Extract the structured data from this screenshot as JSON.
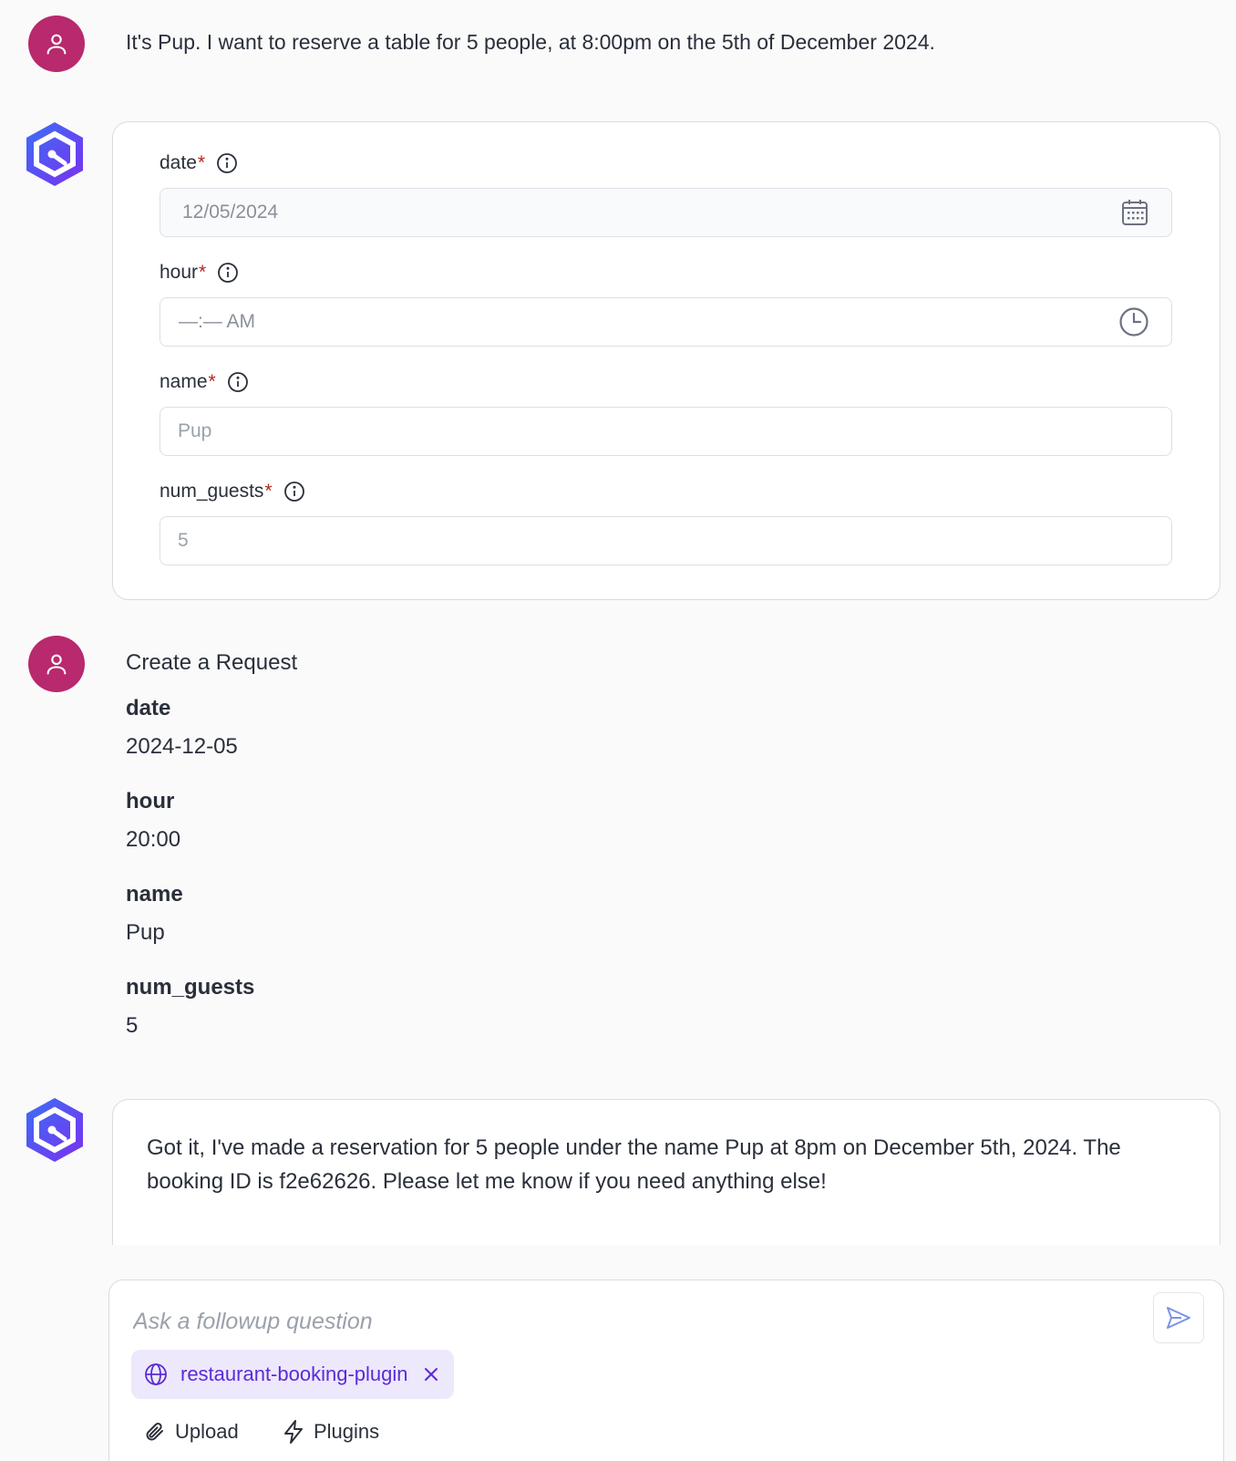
{
  "messages": {
    "user_1": {
      "text": "It's Pup. I want to reserve a table for 5 people, at 8:00pm on the 5th of December 2024."
    },
    "form": {
      "fields": [
        {
          "label": "date",
          "required_mark": "*",
          "value": "12/05/2024",
          "icon": "calendar-icon"
        },
        {
          "label": "hour",
          "required_mark": "*",
          "value": "—:— AM",
          "icon": "clock-icon"
        },
        {
          "label": "name",
          "required_mark": "*",
          "value": "Pup"
        },
        {
          "label": "num_guests",
          "required_mark": "*",
          "value": "5"
        }
      ]
    },
    "request": {
      "title": "Create a Request",
      "items": [
        {
          "key": "date",
          "value": "2024-12-05"
        },
        {
          "key": "hour",
          "value": "20:00"
        },
        {
          "key": "name",
          "value": "Pup"
        },
        {
          "key": "num_guests",
          "value": "5"
        }
      ]
    },
    "reply": {
      "text": "Got it, I've made a reservation for 5 people under the name Pup at 8pm on December 5th, 2024. The booking ID is f2e62626. Please let me know if you need anything else!"
    }
  },
  "composer": {
    "placeholder": "Ask a followup question",
    "chip_label": "restaurant-booking-plugin",
    "upload_label": "Upload",
    "plugins_label": "Plugins"
  },
  "colors": {
    "user_avatar": "#b8296d",
    "bot_gradient_start": "#3b6ff5",
    "bot_gradient_end": "#7b2ff0",
    "required": "#b3261e",
    "chip_bg": "#ede8fb",
    "chip_text": "#5b2bd6"
  }
}
